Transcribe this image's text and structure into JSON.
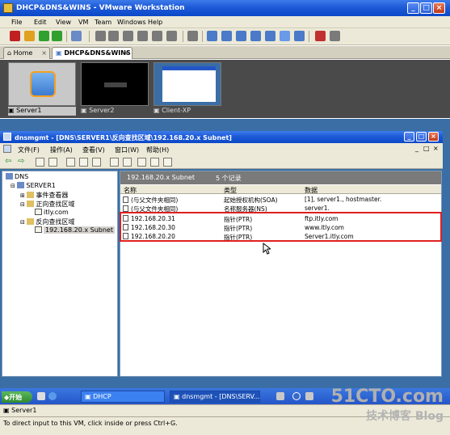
{
  "vmware": {
    "title": "DHCP&DNS&WINS - VMware Workstation",
    "window_buttons": [
      "_",
      "□",
      "×"
    ],
    "menu": [
      "File",
      "Edit",
      "View",
      "VM",
      "Team",
      "Windows",
      "Help"
    ],
    "tabs": [
      {
        "label": "Home",
        "icon": "home-icon"
      },
      {
        "label": "DHCP&DNS&WINS",
        "icon": "vm-icon"
      }
    ],
    "thumbnails": [
      {
        "label": "Server1",
        "selected": true
      },
      {
        "label": "Server2",
        "selected": false
      },
      {
        "label": "Client-XP",
        "selected": false
      }
    ],
    "status_vm": "Server1",
    "hint": "To direct input to this VM, click inside or press Ctrl+G."
  },
  "mmc": {
    "title": "dnsmgmt - [DNS\\SERVER1\\反向查找区域\\192.168.20.x Subnet]",
    "menu": [
      "文件(F)",
      "操作(A)",
      "查看(V)",
      "窗口(W)",
      "帮助(H)"
    ],
    "tree": {
      "root": "DNS",
      "server": "SERVER1",
      "event_viewer": "事件查看器",
      "forward_zone": "正向查找区域",
      "forward_child": "itly.com",
      "reverse_zone": "反向查找区域",
      "reverse_child": "192.168.20.x Subnet"
    },
    "detail_header": {
      "zone": "192.168.20.x Subnet",
      "count": "5 个记录"
    },
    "columns": [
      "名称",
      "类型",
      "数据"
    ],
    "records": [
      {
        "name": "(与父文件夹相同)",
        "type": "起始授权机构(SOA)",
        "data": "[1], server1., hostmaster."
      },
      {
        "name": "(与父文件夹相同)",
        "type": "名称服务器(NS)",
        "data": "server1."
      },
      {
        "name": "192.168.20.31",
        "type": "指针(PTR)",
        "data": "ftp.itly.com"
      },
      {
        "name": "192.168.20.30",
        "type": "指针(PTR)",
        "data": "www.itly.com"
      },
      {
        "name": "192.168.20.20",
        "type": "指针(PTR)",
        "data": "Server1.itly.com"
      }
    ]
  },
  "guest_taskbar": {
    "start": "开始",
    "buttons": [
      "DHCP",
      "dnsmgmt - [DNS\\SERV..."
    ]
  },
  "watermark": {
    "line1": "51CTO.com",
    "line2": "技术博客 Blog"
  }
}
